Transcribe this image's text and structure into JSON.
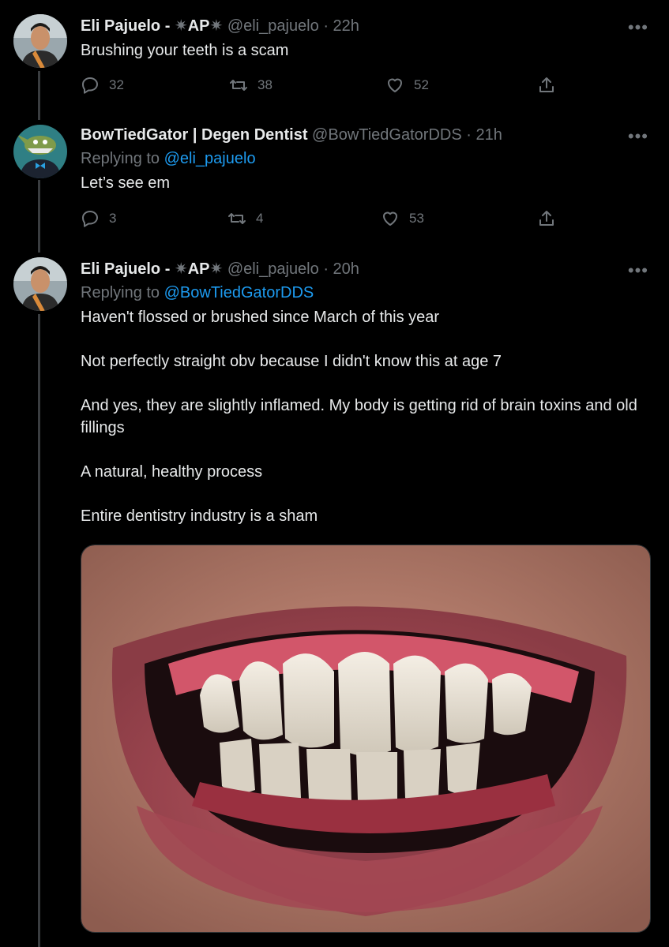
{
  "tweets": [
    {
      "author": "Eli Pajuelo -",
      "badge": "AP",
      "handle": "@eli_pajuelo",
      "time": "22h",
      "reply_prefix": "",
      "reply_to": "",
      "paragraphs": [
        "Brushing your teeth is a scam"
      ],
      "replies": "32",
      "retweets": "38",
      "likes": "52"
    },
    {
      "author": "BowTiedGator | Degen Dentist",
      "badge": "",
      "handle": "@BowTiedGatorDDS",
      "time": "21h",
      "reply_prefix": "Replying to",
      "reply_to": "@eli_pajuelo",
      "paragraphs": [
        "Let’s see em"
      ],
      "replies": "3",
      "retweets": "4",
      "likes": "53"
    },
    {
      "author": "Eli Pajuelo -",
      "badge": "AP",
      "handle": "@eli_pajuelo",
      "time": "20h",
      "reply_prefix": "Replying to",
      "reply_to": "@BowTiedGatorDDS",
      "paragraphs": [
        "Haven't flossed or brushed since March of this year",
        "Not perfectly straight obv because I didn't know this at age 7",
        "And yes, they are slightly inflamed. My body is getting rid of brain toxins and old fillings",
        "A natural, healthy process",
        "Entire dentistry industry is a sham"
      ]
    }
  ],
  "icons": {
    "more": "more-icon",
    "reply": "reply-icon",
    "retweet": "retweet-icon",
    "like": "heart-icon",
    "share": "share-icon",
    "sparkle": "✷"
  },
  "colors": {
    "background": "#000000",
    "text": "#e7e9ea",
    "muted": "#71767b",
    "link": "#1d9bf0",
    "thread_line": "#3a3d40"
  }
}
